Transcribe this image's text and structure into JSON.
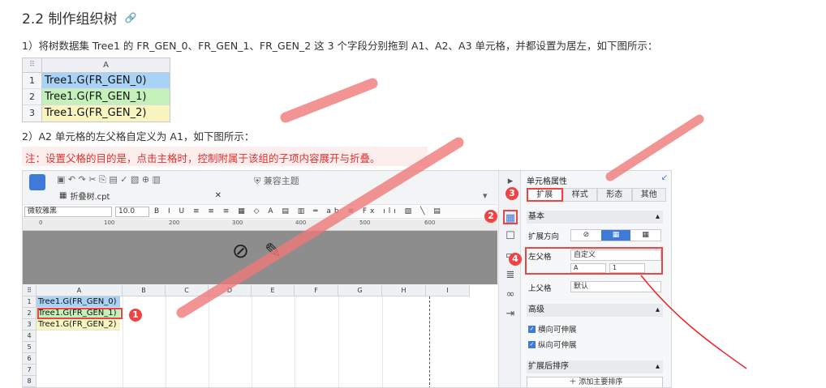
{
  "heading": {
    "text": "2.2 制作组织树",
    "link_icon": "🔗"
  },
  "step1": "1）将树数据集 Tree1 的 FR_GEN_0、FR_GEN_1、FR_GEN_2 这 3 个字段分别拖到 A1、A2、A3 单元格，并都设置为居左，如下图所示：",
  "mini_sheet": {
    "col": "A",
    "corner": "⠿",
    "rows": [
      {
        "n": "1",
        "v": "Tree1.G(FR_GEN_0)",
        "bg": "#a8d3f7"
      },
      {
        "n": "2",
        "v": "Tree1.G(FR_GEN_1)",
        "bg": "#c4f1b9"
      },
      {
        "n": "3",
        "v": "Tree1.G(FR_GEN_2)",
        "bg": "#f8f5c0"
      }
    ]
  },
  "step2": "2）A2 单元格的左父格自定义为 A1，如下图所示：",
  "note": "注：设置父格的目的是，点击主格时，控制附属于该组的子项内容展开与折叠。",
  "designer": {
    "toolbar_theme": "兼容主题",
    "file_tab": "折叠树.cpt",
    "font": "微软雅黑",
    "font_size": "10.0",
    "ruler": [
      "0",
      "100",
      "200",
      "300",
      "400",
      "500",
      "600"
    ],
    "cols": [
      "A",
      "B",
      "C",
      "D",
      "E",
      "F",
      "G",
      "H",
      "I"
    ],
    "rows": [
      "1",
      "2",
      "3",
      "4",
      "5",
      "6",
      "7",
      "8"
    ],
    "cells": [
      "Tree1.G(FR_GEN_0)",
      "Tree1.G(FR_GEN_1)",
      "Tree1.G(FR_GEN_2)"
    ],
    "cell_colors": [
      "#a8d3f7",
      "#c4f1b9",
      "#f8f5c0"
    ]
  },
  "panel": {
    "title": "单元格属性",
    "tabs": [
      "扩展",
      "样式",
      "形态",
      "其他"
    ],
    "basic": "基本",
    "expand_dir": "扩展方向",
    "left_parent": "左父格",
    "left_parent_val": "自定义",
    "left_col": "A",
    "left_row": "1",
    "up_parent": "上父格",
    "up_parent_val": "默认",
    "advanced": "高级",
    "h_expand": "横向可伸展",
    "v_expand": "纵向可伸展",
    "sort": "扩展后排序",
    "add_sort": "添加主要排序"
  },
  "badges": [
    "1",
    "2",
    "3",
    "4"
  ]
}
